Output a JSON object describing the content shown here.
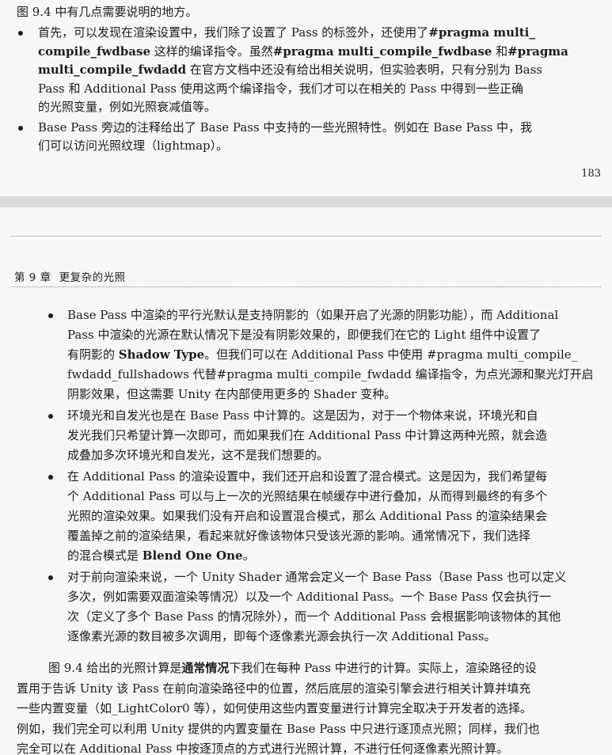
{
  "top_page": {
    "intro": "图 9.4 中有几点需要说明的地方。",
    "bullets": [
      {
        "lines": [
          [
            {
              "t": "首先，可以发现在渲染设置中，我们除了设置了 Pass 的标签外，还使用了"
            },
            {
              "t": "#pragma multi_",
              "b": true
            }
          ],
          [
            {
              "t": "compile_fwdbase",
              "b": true
            },
            {
              "t": " 这样的编译指令。虽然"
            },
            {
              "t": "#pragma multi_compile_fwdbase",
              "b": true
            },
            {
              "t": " 和"
            },
            {
              "t": "#pragma",
              "b": true
            }
          ],
          [
            {
              "t": "multi_compile_fwdadd",
              "b": true
            },
            {
              "t": " 在官方文档中还没有给出相关说明，但实验表明，只有分别为 Bass"
            }
          ],
          [
            {
              "t": "Pass 和 Additional Pass 使用这两个编译指令，我们才可以在相关的 Pass 中得到一些正确"
            }
          ],
          [
            {
              "t": "的光照变量，例如光照衰减值等。"
            }
          ]
        ]
      },
      {
        "lines": [
          [
            {
              "t": "Base Pass 旁边的注释给出了 Base Pass 中支持的一些光照特性。例如在 Base Pass 中，我"
            }
          ],
          [
            {
              "t": "们可以访问光照纹理（lightmap）。"
            }
          ]
        ]
      }
    ],
    "page_number": "183"
  },
  "bottom_page": {
    "chapter_label": "第 9 章",
    "chapter_title": "更复杂的光照",
    "bullets": [
      {
        "lines": [
          [
            {
              "t": "Base Pass 中渲染的平行光默认是支持阴影的（如果开启了光源的阴影功能），而 Additional"
            }
          ],
          [
            {
              "t": "Pass 中渲染的光源在默认情况下是没有阴影效果的，即便我们在它的 Light 组件中设置了"
            }
          ],
          [
            {
              "t": "有阴影的 "
            },
            {
              "t": "Shadow Type",
              "b": true
            },
            {
              "t": "。但我们可以在 Additional Pass 中使用 #pragma multi_compile_"
            }
          ],
          [
            {
              "t": "fwdadd_fullshadows 代替#pragma multi_compile_fwdadd 编译指令，为点光源和聚光灯开启"
            }
          ],
          [
            {
              "t": "阴影效果，但这需要 Unity 在内部使用更多的 Shader 变种。"
            }
          ]
        ]
      },
      {
        "lines": [
          [
            {
              "t": "环境光和自发光也是在 Base Pass 中计算的。这是因为，对于一个物体来说，环境光和自"
            }
          ],
          [
            {
              "t": "发光我们只希望计算一次即可，而如果我们在 Additional Pass 中计算这两种光照，就会造"
            }
          ],
          [
            {
              "t": "成叠加多次环境光和自发光，这不是我们想要的。"
            }
          ]
        ]
      },
      {
        "lines": [
          [
            {
              "t": "在 Additional Pass 的渲染设置中，我们还开启和设置了混合模式。这是因为，我们希望每"
            }
          ],
          [
            {
              "t": "个 Additional Pass 可以与上一次的光照结果在帧缓存中进行叠加，从而得到最终的有多个"
            }
          ],
          [
            {
              "t": "光照的渲染效果。如果我们没有开启和设置混合模式，那么 Additional Pass 的渲染结果会"
            }
          ],
          [
            {
              "t": "覆盖掉之前的渲染结果，看起来就好像该物体只受该光源的影响。通常情况下，我们选择"
            }
          ],
          [
            {
              "t": "的混合模式是 "
            },
            {
              "t": "Blend One One",
              "b": true
            },
            {
              "t": "。"
            }
          ]
        ]
      },
      {
        "lines": [
          [
            {
              "t": "对于前向渲染来说，一个 Unity Shader 通常会定义一个 Base Pass（Base Pass 也可以定义"
            }
          ],
          [
            {
              "t": "多次，例如需要双面渲染等情况）以及一个 Additional Pass。一个 Base Pass 仅会执行一"
            }
          ],
          [
            {
              "t": "次（定义了多个 Base Pass 的情况除外），而一个 Additional Pass 会根据影响该物体的其他"
            }
          ],
          [
            {
              "t": "逐像素光源的数目被多次调用，即每个逐像素光源会执行一次 Additional Pass。"
            }
          ]
        ]
      }
    ],
    "paragraph": [
      [
        {
          "t": "图 9.4 给出的光照计算是"
        },
        {
          "t": "通常情况",
          "b": true
        },
        {
          "t": "下我们在每种 Pass 中进行的计算。实际上，渲染路径的设"
        }
      ],
      [
        {
          "t": "置用于告诉 Unity 该 Pass 在前向渲染路径中的位置，然后底层的渲染引擎会进行相关计算并填充"
        }
      ],
      [
        {
          "t": "一些内置变量（如_LightColor0 等），如何使用这些内置变量进行计算完全取决于开发者的选择。"
        }
      ],
      [
        {
          "t": "例如，我们完全可以利用 Unity 提供的内置变量在 Base Pass 中只进行逐顶点光照；同样，我们也"
        }
      ],
      [
        {
          "t": "完全可以在 Additional Pass 中按逐顶点的方式进行光照计算，不进行任何逐像素光照计算。"
        }
      ]
    ]
  }
}
